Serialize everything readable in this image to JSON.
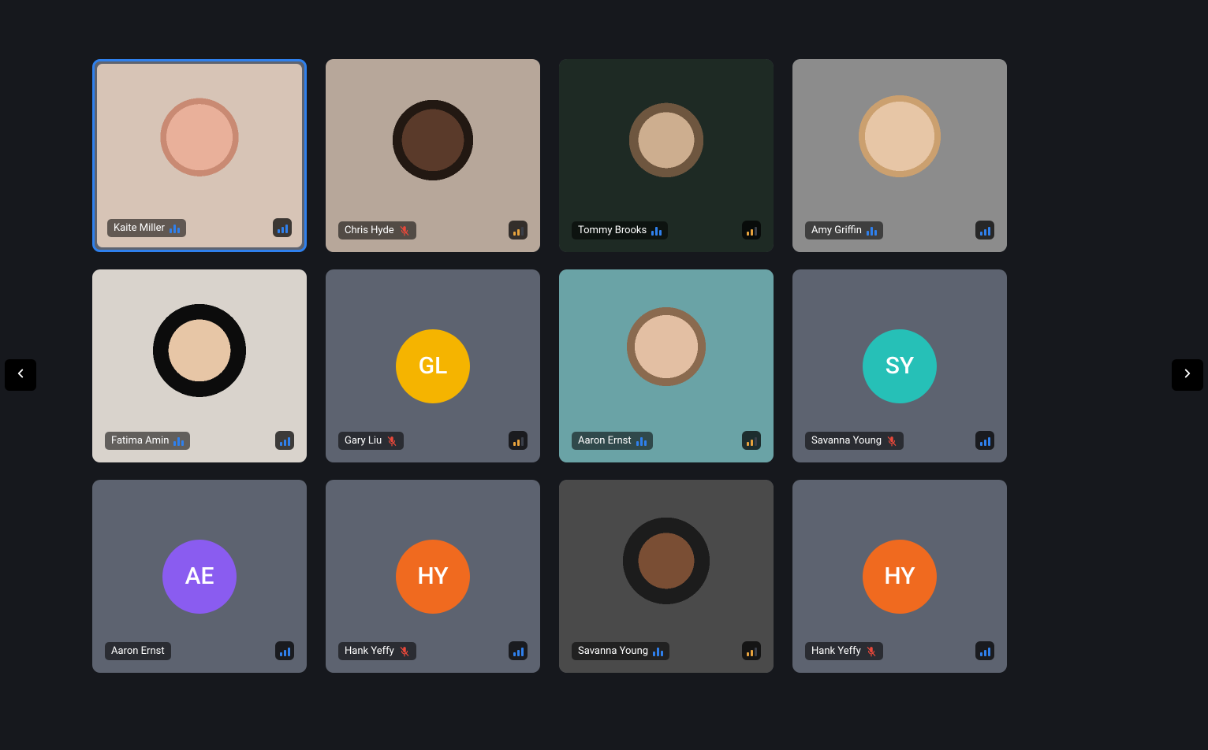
{
  "colors": {
    "accent": "#2f80ed",
    "danger": "#e9483a",
    "bg": "#16181d",
    "tile_bg": "#5d6370"
  },
  "participants": [
    {
      "name": "Kaite Miller",
      "has_video": true,
      "initials": "",
      "avatar_color": "",
      "voice": "speaking",
      "signal": "full",
      "selected": true,
      "cam_class": "cam-bg-0"
    },
    {
      "name": "Chris Hyde",
      "has_video": true,
      "initials": "",
      "avatar_color": "",
      "voice": "muted",
      "signal": "amber",
      "selected": false,
      "cam_class": "cam-bg-1"
    },
    {
      "name": "Tommy Brooks",
      "has_video": true,
      "initials": "",
      "avatar_color": "",
      "voice": "speaking",
      "signal": "amber",
      "selected": false,
      "cam_class": "cam-bg-2"
    },
    {
      "name": "Amy Griffin",
      "has_video": true,
      "initials": "",
      "avatar_color": "",
      "voice": "speaking",
      "signal": "full",
      "selected": false,
      "cam_class": "cam-bg-3"
    },
    {
      "name": "Fatima Amin",
      "has_video": true,
      "initials": "",
      "avatar_color": "",
      "voice": "speaking",
      "signal": "full",
      "selected": false,
      "cam_class": "cam-bg-4"
    },
    {
      "name": "Gary Liu",
      "has_video": false,
      "initials": "GL",
      "avatar_color": "#f5b400",
      "voice": "muted",
      "signal": "amber",
      "selected": false,
      "cam_class": ""
    },
    {
      "name": "Aaron Ernst",
      "has_video": true,
      "initials": "",
      "avatar_color": "",
      "voice": "speaking",
      "signal": "amber",
      "selected": false,
      "cam_class": "cam-bg-6"
    },
    {
      "name": "Savanna Young",
      "has_video": false,
      "initials": "SY",
      "avatar_color": "#26c0b7",
      "voice": "muted",
      "signal": "full",
      "selected": false,
      "cam_class": ""
    },
    {
      "name": "Aaron Ernst",
      "has_video": false,
      "initials": "AE",
      "avatar_color": "#8a5cf0",
      "voice": "none",
      "signal": "full",
      "selected": false,
      "cam_class": ""
    },
    {
      "name": "Hank Yeffy",
      "has_video": false,
      "initials": "HY",
      "avatar_color": "#f06a1f",
      "voice": "muted",
      "signal": "full",
      "selected": false,
      "cam_class": ""
    },
    {
      "name": "Savanna Young",
      "has_video": true,
      "initials": "",
      "avatar_color": "",
      "voice": "speaking",
      "signal": "amber",
      "selected": false,
      "cam_class": "cam-bg-10"
    },
    {
      "name": "Hank Yeffy",
      "has_video": false,
      "initials": "HY",
      "avatar_color": "#f06a1f",
      "voice": "muted",
      "signal": "full",
      "selected": false,
      "cam_class": ""
    }
  ]
}
